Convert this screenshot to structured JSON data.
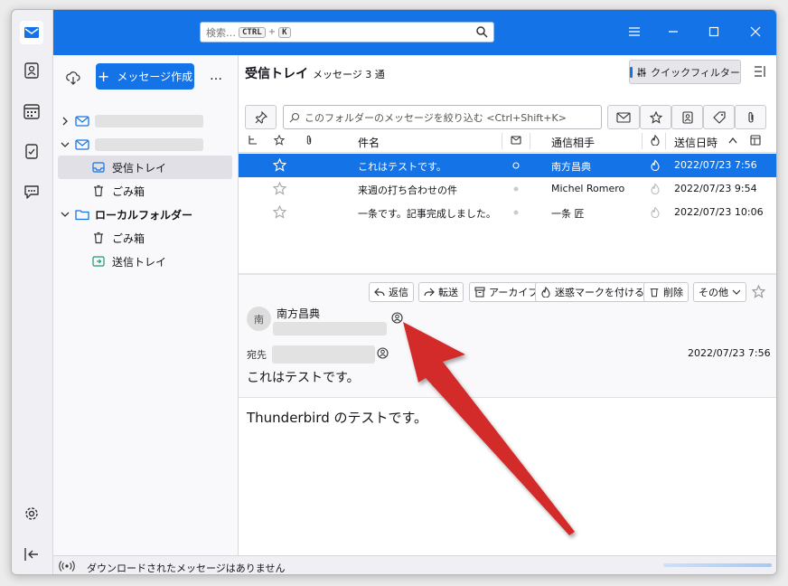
{
  "search": {
    "placeholder": "検索…",
    "key1": "CTRL",
    "plus": "+",
    "key2": "K"
  },
  "folder_pane": {
    "compose_label": "メッセージ作成",
    "more_label": "…",
    "inbox": "受信トレイ",
    "trash": "ごみ箱",
    "local_folders": "ローカルフォルダー",
    "local_trash": "ごみ箱",
    "outbox": "送信トレイ"
  },
  "list_header": {
    "folder_name": "受信トレイ",
    "message_count": "メッセージ 3 通",
    "quick_filter": "クイックフィルター"
  },
  "filter": {
    "placeholder": "このフォルダーのメッセージを絞り込む <Ctrl+Shift+K>"
  },
  "columns": {
    "subject": "件名",
    "correspondent": "通信相手",
    "date": "送信日時"
  },
  "messages": [
    {
      "subject": "これはテストです。",
      "from": "南方昌典",
      "date": "2022/07/23 7:56",
      "selected": true
    },
    {
      "subject": "来週の打ち合わせの件",
      "from": "Michel Romero",
      "date": "2022/07/23 9:54",
      "selected": false
    },
    {
      "subject": "一条です。記事完成しました。",
      "from": "一条 匠",
      "date": "2022/07/23 10:06",
      "selected": false
    }
  ],
  "message_header": {
    "actions": {
      "reply": "返信",
      "forward": "転送",
      "archive": "アーカイブ",
      "junk": "迷惑マークを付ける",
      "delete": "削除",
      "other": "その他"
    },
    "avatar_initial": "南",
    "from_name": "南方昌典",
    "to_label": "宛先",
    "date": "2022/07/23 7:56",
    "subject": "これはテストです。"
  },
  "body": {
    "text": "Thunderbird のテストです。"
  },
  "status": {
    "text": "ダウンロードされたメッセージはありません"
  },
  "colors": {
    "accent": "#1473e6",
    "arrow": "#d32a2a"
  }
}
